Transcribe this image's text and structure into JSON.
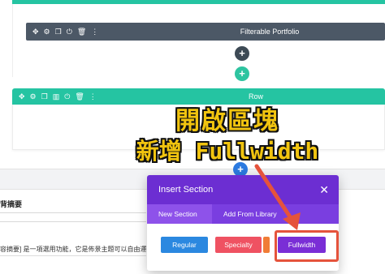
{
  "builder": {
    "module": {
      "title": "Filterable Portfolio",
      "toolbar_icons": [
        "move-icon",
        "gear-icon",
        "duplicate-icon",
        "power-icon",
        "trash-icon",
        "more-icon"
      ]
    },
    "row": {
      "title": "Row",
      "toolbar_icons": [
        "move-icon",
        "gear-icon",
        "duplicate-icon",
        "columns-icon",
        "power-icon",
        "trash-icon",
        "more-icon"
      ]
    },
    "add_button_symbol": "+"
  },
  "document": {
    "heading": "背摘要",
    "body_text": "容摘要] 是一項選用功能，它是佈景主題可以自由運用"
  },
  "caption": {
    "line1": "開啟區塊",
    "line2": "新增 Fullwidth"
  },
  "modal": {
    "title": "Insert Section",
    "close_symbol": "✕",
    "tabs": [
      {
        "label": "New Section",
        "active": true
      },
      {
        "label": "Add From Library",
        "active": false
      }
    ],
    "buttons": {
      "regular": "Regular",
      "specialty": "Specialty",
      "fullwidth": "Fullwidth"
    }
  },
  "colors": {
    "row_teal": "#25c4a2",
    "module_bar": "#4c5866",
    "modal_purple": "#6c2ed2",
    "regular_blue": "#2b88e0",
    "specialty_red": "#ef5262",
    "fullwidth_purple": "#7a2ed6",
    "annotation_red": "#e5533c",
    "caption_yellow": "#f1c40f"
  }
}
